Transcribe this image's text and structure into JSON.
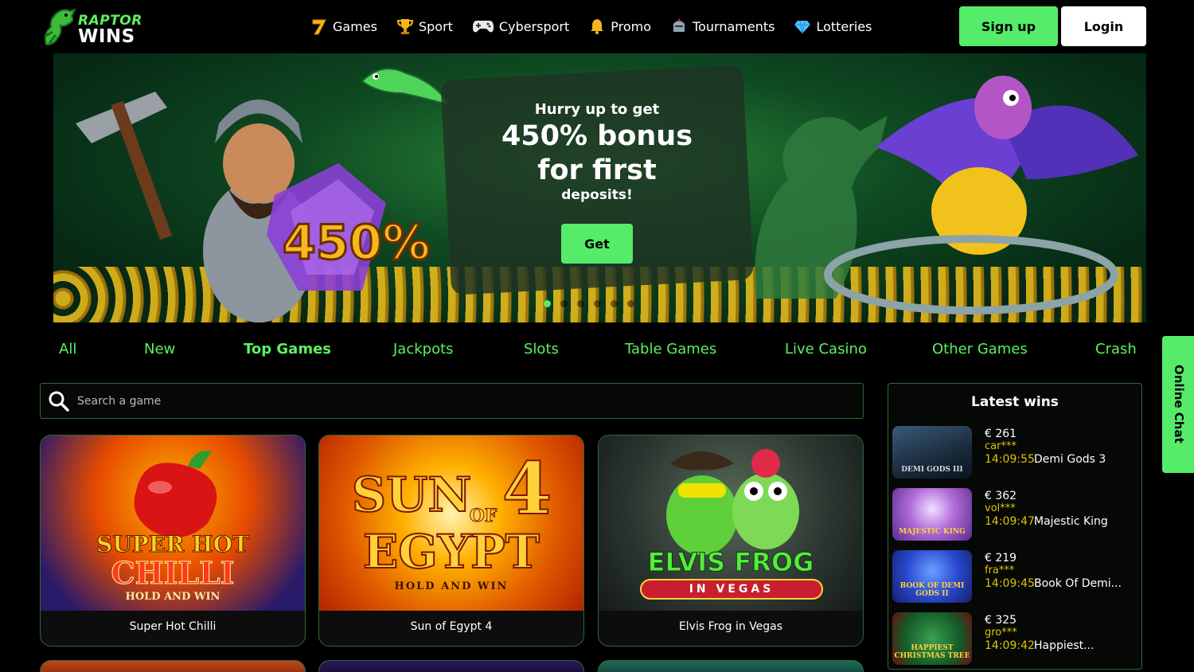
{
  "brand": {
    "line1": "RAPTOR",
    "line2": "WINS"
  },
  "nav": [
    {
      "label": "Games",
      "icon": "seven-icon"
    },
    {
      "label": "Sport",
      "icon": "trophy-icon"
    },
    {
      "label": "Cybersport",
      "icon": "gamepad-icon"
    },
    {
      "label": "Promo",
      "icon": "bell-icon"
    },
    {
      "label": "Tournaments",
      "icon": "knight-helmet-icon"
    },
    {
      "label": "Lotteries",
      "icon": "diamond-icon"
    }
  ],
  "auth": {
    "signup": "Sign up",
    "login": "Login"
  },
  "hero": {
    "subtitle": "Hurry up to get",
    "title_line1": "450% bonus",
    "title_line2": "for first",
    "subtitle2": "deposits!",
    "badge": "450%",
    "cta": "Get",
    "slides": 6,
    "active_slide": 1
  },
  "categories": [
    "All",
    "New",
    "Top Games",
    "Jackpots",
    "Slots",
    "Table Games",
    "Live Casino",
    "Other Games",
    "Crash"
  ],
  "active_category": "Top Games",
  "search": {
    "placeholder": "Search a game"
  },
  "games": [
    {
      "name": "Super Hot Chilli",
      "art_line1": "SUPER HOT",
      "art_line2": "CHILLI",
      "art_line3": "HOLD AND WIN"
    },
    {
      "name": "Sun of Egypt 4",
      "art_line1": "SUN",
      "art_line2": "EGYPT",
      "art_line3": "HOLD AND WIN",
      "art_num": "4",
      "art_of": "OF"
    },
    {
      "name": "Elvis Frog in Vegas",
      "art_line1": "ELVIS FROG",
      "art_line2": "IN VEGAS"
    }
  ],
  "latest_wins": {
    "title": "Latest wins",
    "items": [
      {
        "amount": "€ 261",
        "user": "car***",
        "time": "14:09:55",
        "game": "Demi Gods 3",
        "thumb_label": "DEMI GODS III"
      },
      {
        "amount": "€ 362",
        "user": "vol***",
        "time": "14:09:47",
        "game": "Majestic King",
        "thumb_label": "MAJESTIC KING"
      },
      {
        "amount": "€ 219",
        "user": "fra***",
        "time": "14:09:45",
        "game": "Book Of Demi...",
        "thumb_label": "BOOK OF DEMI GODS II"
      },
      {
        "amount": "€ 325",
        "user": "gro***",
        "time": "14:09:42",
        "game": "Happiest...",
        "thumb_label": "HAPPIEST CHRISTMAS TREE"
      }
    ]
  },
  "chat": {
    "label": "Online Chat"
  },
  "colors": {
    "accent": "#55ec6a",
    "tab_text": "#5cf25e",
    "border": "#2f6b34",
    "win_meta": "#e2c400"
  }
}
